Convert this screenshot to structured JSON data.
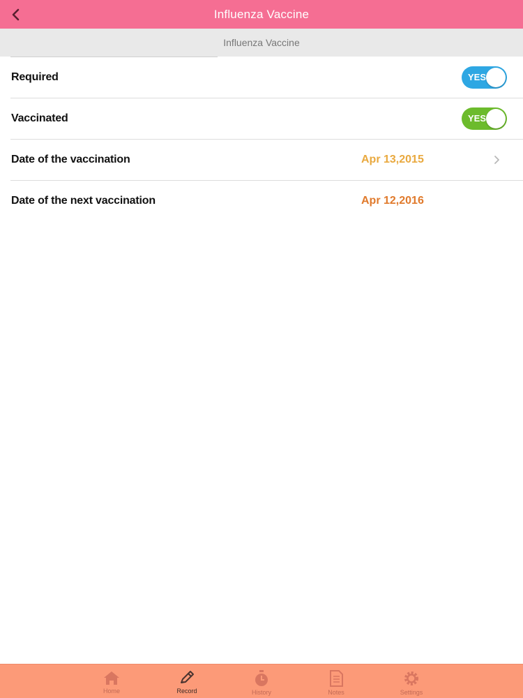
{
  "header": {
    "title": "Influenza Vaccine",
    "back_icon": "chevron-left-icon"
  },
  "subheader": {
    "title": "Influenza Vaccine"
  },
  "rows": [
    {
      "label": "Required",
      "toggle": {
        "label": "YES",
        "color": "#2ea7e3"
      }
    },
    {
      "label": "Vaccinated",
      "toggle": {
        "label": "YES",
        "color": "#6cbb2c"
      }
    },
    {
      "label": "Date of the vaccination",
      "value": "Apr 13,2015",
      "value_color": "#e9a93f"
    },
    {
      "label": "Date of the next vaccination",
      "value": "Apr 12,2016",
      "value_color": "#e07a2c"
    }
  ],
  "tabbar": {
    "items": [
      {
        "label": "Home",
        "icon": "home-icon"
      },
      {
        "label": "Record",
        "icon": "pencil-icon",
        "active": true
      },
      {
        "label": "History",
        "icon": "stopwatch-icon"
      },
      {
        "label": "Notes",
        "icon": "notes-icon"
      },
      {
        "label": "Settings",
        "icon": "gear-icon"
      }
    ]
  },
  "colors": {
    "navbar": "#f56e93",
    "tabbar": "#fc9a78"
  }
}
